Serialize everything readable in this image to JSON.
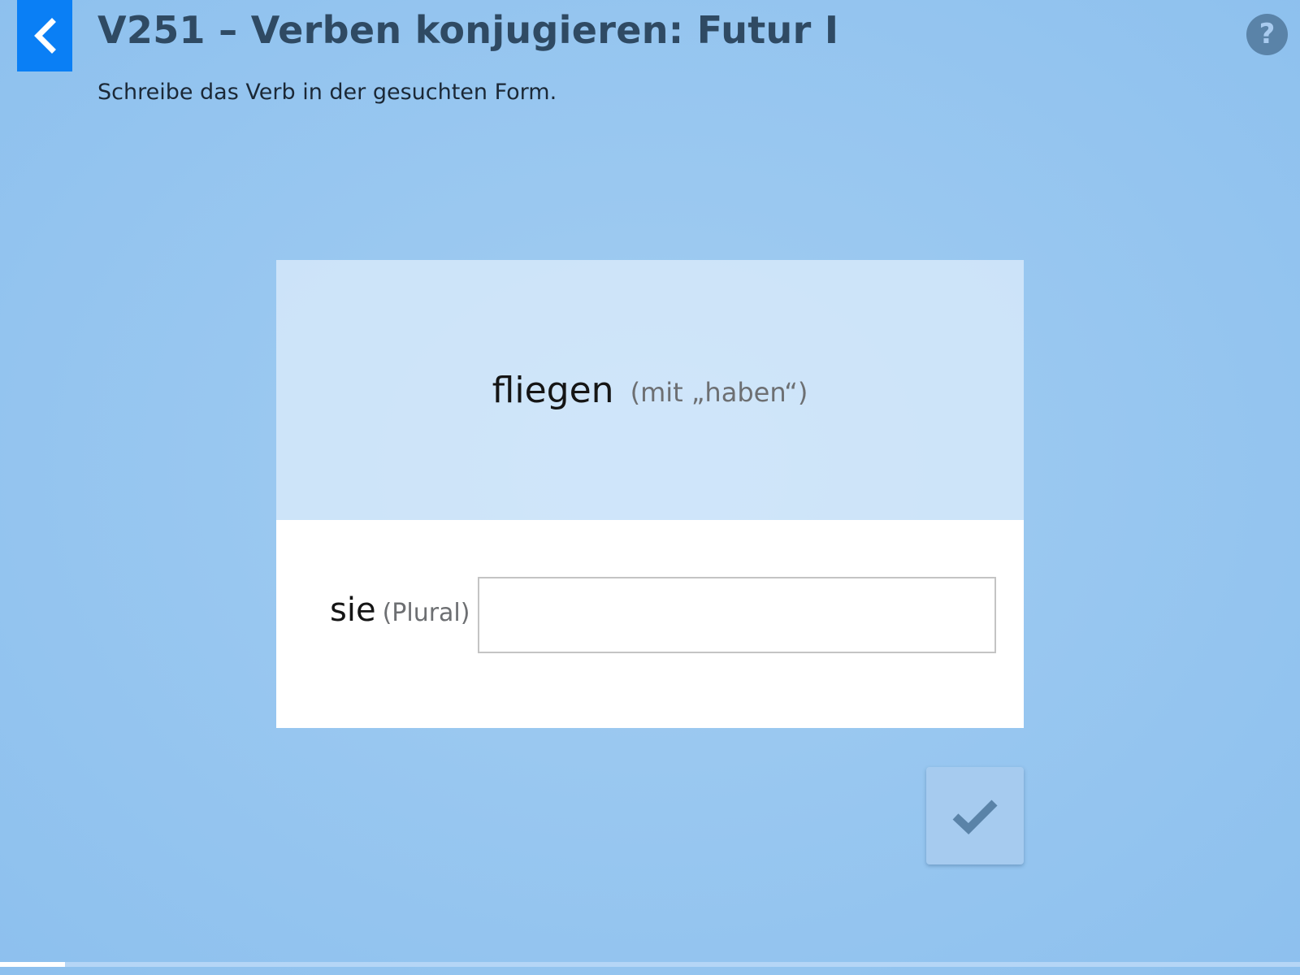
{
  "header": {
    "title": "V251 – Verben konjugieren: Futur I",
    "instruction": "Schreibe das Verb in der gesuchten Form.",
    "back_icon": "chevron-left-icon",
    "help_label": "?"
  },
  "exercise": {
    "verb": "fliegen",
    "verb_hint": "(mit „haben“)",
    "pronoun": "sie",
    "pronoun_hint": "(Plural)",
    "answer_value": "",
    "answer_placeholder": ""
  },
  "submit": {
    "icon": "checkmark-icon"
  },
  "progress": {
    "fraction": 0.05
  },
  "colors": {
    "back_button": "#0a7ff5",
    "title": "#2f4a63",
    "help_button": "#5a83a8",
    "check_icon": "#5a83a8",
    "progress_fill": "#ffffff",
    "progress_track": "#b5d6f6"
  }
}
